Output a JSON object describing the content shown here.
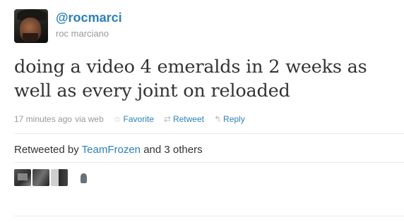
{
  "user": {
    "screen_name": "@rocmarci",
    "full_name": "roc marciano"
  },
  "tweet": {
    "text": "doing a video 4 emeralds in 2 weeks as well as every joint on reloaded",
    "timestamp": "17 minutes ago",
    "via": "via web"
  },
  "actions": {
    "favorite": "Favorite",
    "retweet": "Retweet",
    "reply": "Reply"
  },
  "retweets": {
    "prefix": "Retweeted by",
    "user": "TeamFrozen",
    "suffix": "and 3 others"
  },
  "icons": [
    "star-icon",
    "retweet-icon",
    "reply-icon"
  ],
  "colors": {
    "link": "#2b80b9",
    "meta": "#999999",
    "text": "#333333"
  }
}
